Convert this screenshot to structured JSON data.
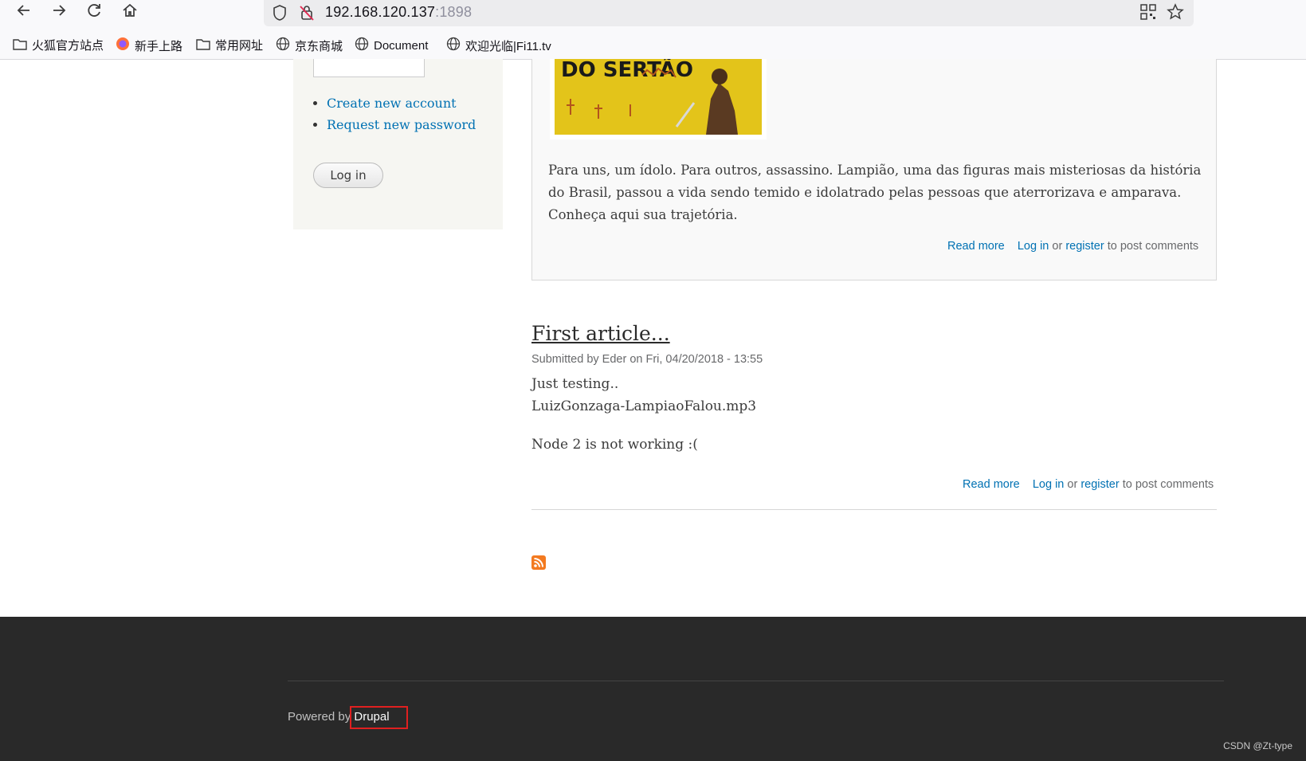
{
  "browser": {
    "url_host": "192.168.120.137",
    "url_port": ":1898",
    "icons": [
      "back-arrow-icon",
      "forward-arrow-icon",
      "reload-icon",
      "home-icon",
      "shield-icon",
      "insecure-lock-icon",
      "qr-code-icon",
      "bookmark-star-icon"
    ],
    "bookmarks": [
      {
        "label": "火狐官方站点",
        "icon": "folder-icon"
      },
      {
        "label": "新手上路",
        "icon": "firefox-icon"
      },
      {
        "label": "常用网址",
        "icon": "folder-icon"
      },
      {
        "label": "京东商城",
        "icon": "globe-icon"
      },
      {
        "label": "Document",
        "icon": "globe-icon"
      },
      {
        "label": "欢迎光临|Fi11.tv",
        "icon": "globe-icon"
      }
    ]
  },
  "sidebar": {
    "create_account": "Create new account",
    "request_password": "Request new password",
    "login_button": "Log in"
  },
  "article1": {
    "teaser": "Para uns, um ídolo. Para outros, assassino. Lampião, uma das figuras mais misteriosas da história do Brasil, passou a vida sendo temido e idolatrado pelas pessoas que aterrorizava e amparava. Conheça aqui sua trajetória.",
    "poster_text": "DO SERTÃO",
    "read_more": "Read more",
    "log_in": "Log in",
    "or": "or",
    "register": "register",
    "to_post": "to post comments"
  },
  "article2": {
    "title": "First article...",
    "submitted": "Submitted by Eder on Fri, 04/20/2018 - 13:55",
    "line1": "Just testing..",
    "line2": "LuizGonzaga-LampiaoFalou.mp3",
    "line3": "Node 2 is not working :(",
    "read_more": "Read more",
    "log_in": "Log in",
    "or": "or",
    "register": "register",
    "to_post": "to post comments"
  },
  "footer": {
    "powered_by": "Powered by",
    "drupal": "Drupal",
    "watermark": "CSDN @Zt-type"
  },
  "colors": {
    "link": "#0071b3",
    "footer_bg": "#292929",
    "highlight": "#e02020"
  }
}
